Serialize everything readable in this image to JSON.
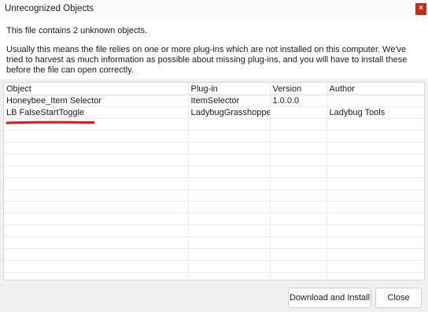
{
  "window": {
    "title": "Unrecognized Objects",
    "close_glyph": "×"
  },
  "message": {
    "summary": "This file contains 2 unknown objects.",
    "explanation": "Usually this means the file relies on one or more plug-ins which are not installed on this computer. We've tried to harvest as much information as possible about missing plug-ins, and you will have to install these before the file can open  correctly."
  },
  "table": {
    "headers": [
      "Object",
      "Plug-in",
      "Version",
      "Author"
    ],
    "rows": [
      [
        "Honeybee_Item Selector",
        "ItemSelector",
        "1.0.0.0",
        ""
      ],
      [
        "LB FalseStartToggle",
        "LadybugGrasshopper",
        "",
        "Ladybug Tools"
      ]
    ]
  },
  "buttons": {
    "install": "Download and Install",
    "close": "Close"
  },
  "colors": {
    "close_red": "#c42b1c",
    "annotation_red": "#e8101a"
  }
}
